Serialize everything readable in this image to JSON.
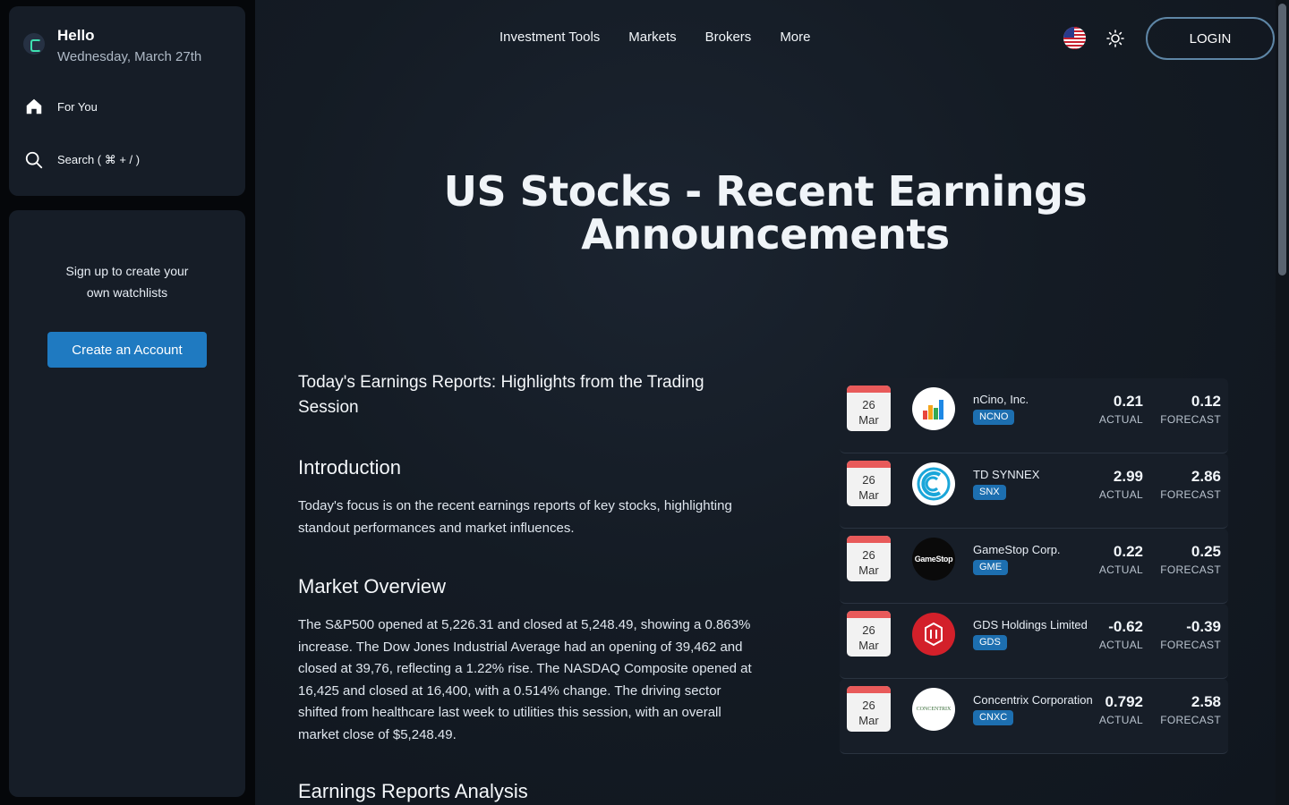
{
  "sidebar": {
    "greeting": "Hello",
    "date": "Wednesday, March 27th",
    "nav": [
      {
        "label": "For You",
        "icon": "home-icon"
      },
      {
        "label": "Search ( ⌘ + / )",
        "icon": "search-icon"
      }
    ],
    "signup_text": "Sign up to create your own watchlists",
    "create_button": "Create an Account"
  },
  "header": {
    "menu": [
      "Investment Tools",
      "Markets",
      "Brokers",
      "More"
    ],
    "login": "LOGIN"
  },
  "page": {
    "title": "US Stocks - Recent Earnings Announcements"
  },
  "article": {
    "heading": "Today's Earnings Reports: Highlights from the Trading Session",
    "intro_heading": "Introduction",
    "intro_text": "Today's focus is on the recent earnings reports of key stocks, highlighting standout performances and market influences.",
    "market_heading": "Market Overview",
    "market_text": "The S&P500 opened at 5,226.31 and closed at 5,248.49, showing a 0.863% increase. The Dow Jones Industrial Average had an opening of 39,462 and closed at 39,76, reflecting a 1.22% rise. The NASDAQ Composite opened at 16,425 and closed at 16,400, with a 0.514% change. The driving sector shifted from healthcare last week to utilities this session, with an overall market close of $5,248.49.",
    "analysis_heading": "Earnings Reports Analysis"
  },
  "earnings": {
    "actual_label": "ACTUAL",
    "forecast_label": "FORECAST",
    "rows": [
      {
        "day": "26",
        "month": "Mar",
        "company": "nCino, Inc.",
        "ticker": "NCNO",
        "actual": "0.21",
        "forecast": "0.12",
        "logo": "ncino-logo"
      },
      {
        "day": "26",
        "month": "Mar",
        "company": "TD SYNNEX",
        "ticker": "SNX",
        "actual": "2.99",
        "forecast": "2.86",
        "logo": "td-synnex-logo"
      },
      {
        "day": "26",
        "month": "Mar",
        "company": "GameStop Corp.",
        "ticker": "GME",
        "actual": "0.22",
        "forecast": "0.25",
        "logo": "gamestop-logo",
        "logo_text": "GameStop"
      },
      {
        "day": "26",
        "month": "Mar",
        "company": "GDS Holdings Limited",
        "ticker": "GDS",
        "actual": "-0.62",
        "forecast": "-0.39",
        "logo": "gds-logo"
      },
      {
        "day": "26",
        "month": "Mar",
        "company": "Concentrix Corporation",
        "ticker": "CNXC",
        "actual": "0.792",
        "forecast": "2.58",
        "logo": "concentrix-logo",
        "logo_text": "CONCENTRIX"
      }
    ]
  },
  "colors": {
    "accent": "#1f7ac1",
    "ticker_badge": "#1d6fb0",
    "calendar_top": "#e85a5a"
  }
}
